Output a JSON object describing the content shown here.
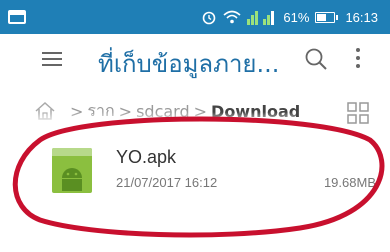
{
  "status_bar": {
    "signal_text": "1 1",
    "battery_percent": "61%",
    "battery_level": 0.61,
    "time": "16:13",
    "icons": [
      "notification-icon",
      "alarm-icon",
      "wifi-icon",
      "signal-icon",
      "battery-icon"
    ],
    "color": "#1f7fb6"
  },
  "toolbar": {
    "title": "ที่เก็บข้อมูลภาย...",
    "icons": [
      "hamburger-icon",
      "search-icon",
      "overflow-menu-icon"
    ],
    "title_color": "#1f6fa6"
  },
  "breadcrumb": {
    "items": [
      "ราก",
      "sdcard",
      "Download"
    ],
    "separator": ">",
    "icons": [
      "home-icon",
      "grid-view-icon"
    ]
  },
  "file": {
    "name": "YO.apk",
    "date": "21/07/2017 16:12",
    "size": "19.68MB",
    "icon": "android-apk-icon"
  },
  "annotation": {
    "type": "hand-drawn-ellipse",
    "color": "#c8102e"
  }
}
